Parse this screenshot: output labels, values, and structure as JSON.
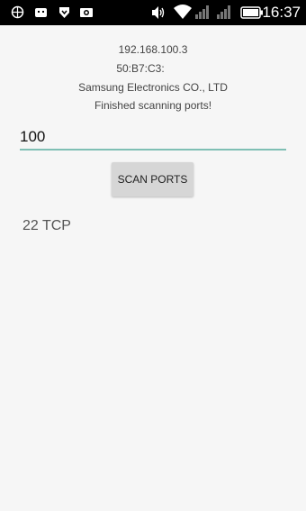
{
  "status_bar": {
    "icons": [
      "ubuntu-like-app-icon",
      "android-debug-icon",
      "download-shield-icon",
      "photo-icon",
      "volume-icon",
      "wifi-icon",
      "signal-icon",
      "signal-icon",
      "battery-icon"
    ],
    "time": "16:37"
  },
  "device": {
    "ip": "192.168.100.3",
    "mac": "50:B7:C3:",
    "vendor": "Samsung Electronics CO., LTD",
    "status": "Finished scanning ports!"
  },
  "port_input": {
    "value": "100"
  },
  "scan_button": {
    "label": "SCAN PORTS"
  },
  "results": [
    "22 TCP"
  ]
}
